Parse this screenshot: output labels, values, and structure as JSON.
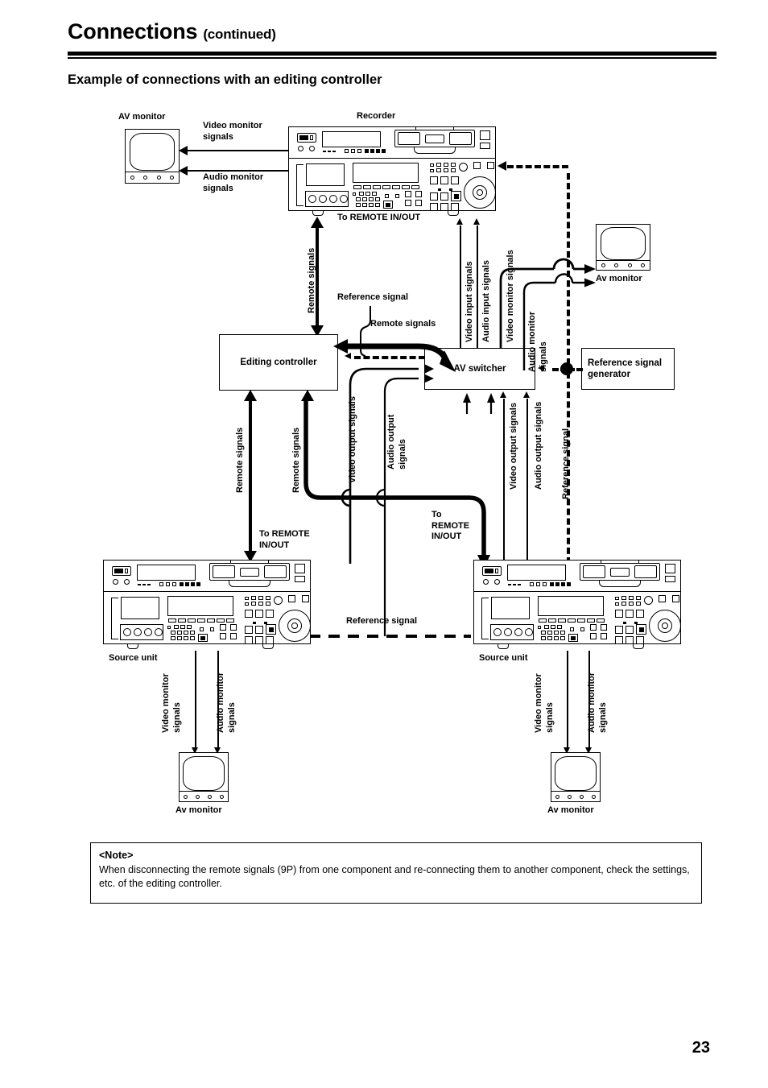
{
  "header": {
    "title": "Connections",
    "continued": "(continued)",
    "section_title": "Example of connections with an editing controller"
  },
  "page_number": "23",
  "note": {
    "title": "<Note>",
    "text": "When disconnecting the remote signals (9P) from one component and re-connecting them to another component, check the settings, etc. of the editing controller."
  },
  "devices": {
    "recorder": "Recorder",
    "editing_controller": "Editing controller",
    "av_switcher": "AV switcher",
    "reference_signal_generator": "Reference signal\ngenerator",
    "av_monitor_top_left": "AV monitor",
    "av_monitor_right": "Av monitor",
    "av_monitor_bottom_left": "Av monitor",
    "av_monitor_bottom_right": "Av monitor",
    "source_unit_left": "Source unit",
    "source_unit_right": "Source unit"
  },
  "signals": {
    "video_monitor_signals": "Video monitor\nsignals",
    "audio_monitor_signals": "Audio monitor\nsignals",
    "video_monitor_signals_1line": "Video monitor signals",
    "audio_monitor_signals_1line": "Audio monitor signals",
    "video_input_signals": "Video input signals",
    "audio_input_signals": "Audio input signals",
    "video_output_signals": "Video output signals",
    "audio_output_signals": "Audio output\nsignals",
    "audio_output_signals_1line": "Audio output signals",
    "remote_signals": "Remote signals",
    "reference_signal": "Reference signal",
    "to_remote_in_out": "To REMOTE IN/OUT",
    "to_remote_in_out_3line": "To\nREMOTE\nIN/OUT",
    "to_remote_in_out_2line": "To REMOTE\nIN/OUT"
  },
  "colors": {
    "ink": "#000000",
    "paper": "#ffffff"
  }
}
